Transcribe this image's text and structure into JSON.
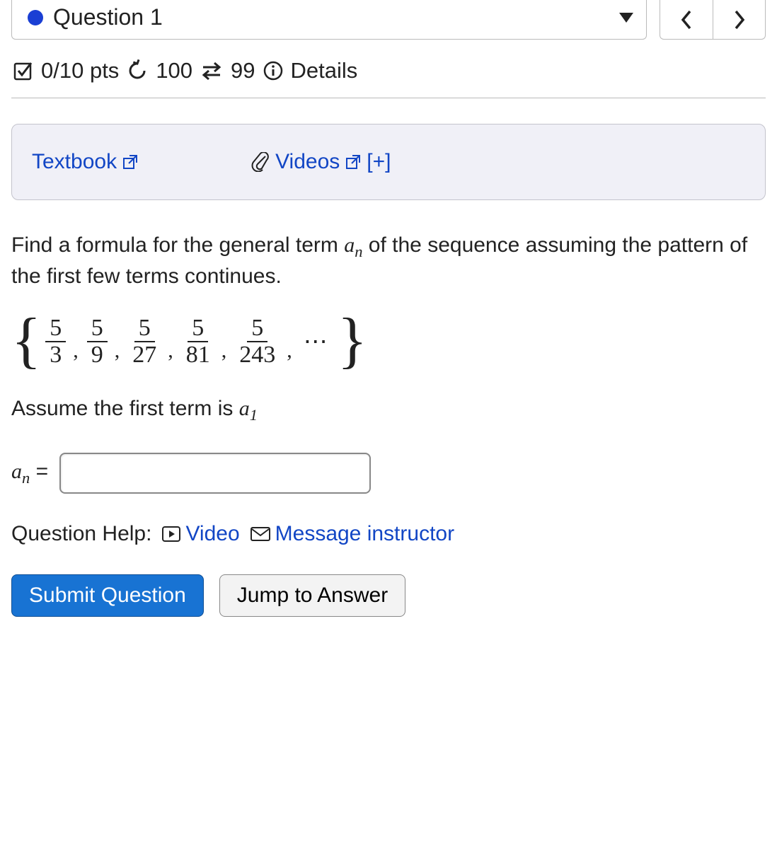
{
  "header": {
    "question_label": "Question 1"
  },
  "meta": {
    "score": "0/10 pts",
    "attempts": "100",
    "swap": "99",
    "details_label": "Details"
  },
  "resources": {
    "textbook_label": "Textbook",
    "videos_label": "Videos",
    "videos_expand": "[+]"
  },
  "prompt": {
    "line1_a": "Find a formula for the general term ",
    "line1_var": "a",
    "line1_sub": "n",
    "line1_b": " of the sequence assuming the pattern of the first few terms continues."
  },
  "sequence": {
    "terms": [
      {
        "num": "5",
        "den": "3"
      },
      {
        "num": "5",
        "den": "9"
      },
      {
        "num": "5",
        "den": "27"
      },
      {
        "num": "5",
        "den": "81"
      },
      {
        "num": "5",
        "den": "243"
      }
    ],
    "ellipsis": "⋯"
  },
  "assume": {
    "text_a": "Assume the first term is ",
    "var": "a",
    "sub": "1"
  },
  "answer": {
    "lhs_var": "a",
    "lhs_sub": "n",
    "eq": " = ",
    "value": ""
  },
  "help": {
    "label": "Question Help:",
    "video": "Video",
    "message": "Message instructor"
  },
  "buttons": {
    "submit": "Submit Question",
    "jump": "Jump to Answer"
  }
}
